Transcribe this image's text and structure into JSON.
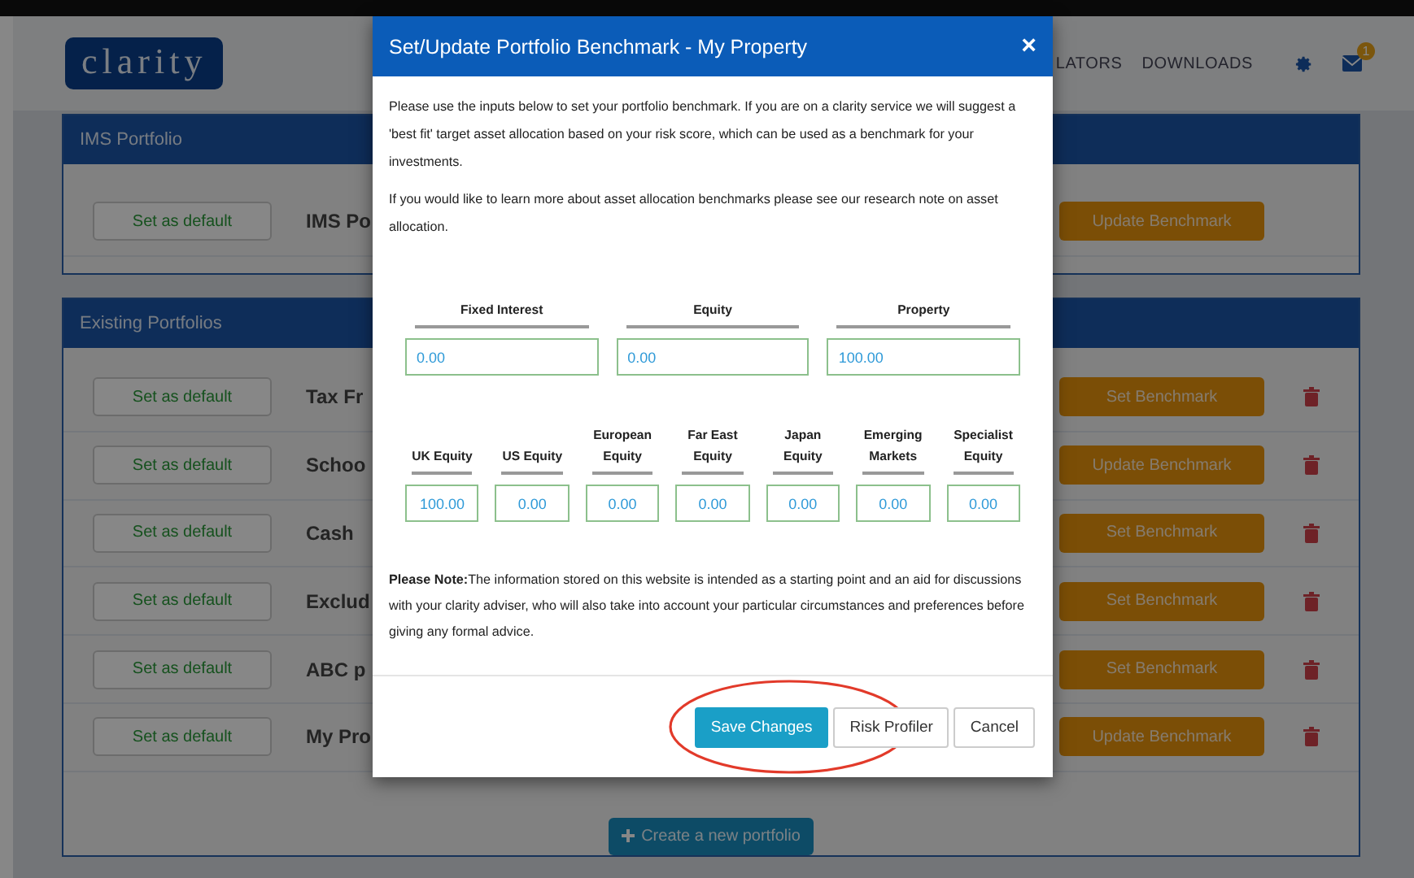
{
  "header": {
    "logo": "clarity",
    "nav": [
      "LATORS",
      "DOWNLOADS"
    ],
    "notification_badge": "1"
  },
  "ims_panel": {
    "title": "IMS Portfolio",
    "rows": [
      {
        "default_button": "Set as default",
        "name": "IMS Po",
        "benchmark_button": "Update Benchmark",
        "deletable": false
      }
    ]
  },
  "existing_panel": {
    "title": "Existing Portfolios",
    "rows": [
      {
        "default_button": "Set as default",
        "name": "Tax Fr",
        "benchmark_button": "Set Benchmark",
        "deletable": true
      },
      {
        "default_button": "Set as default",
        "name": "Schoo",
        "benchmark_button": "Update Benchmark",
        "deletable": true
      },
      {
        "default_button": "Set as default",
        "name": "Cash",
        "benchmark_button": "Set Benchmark",
        "deletable": true
      },
      {
        "default_button": "Set as default",
        "name": "Exclud",
        "benchmark_button": "Set Benchmark",
        "deletable": true
      },
      {
        "default_button": "Set as default",
        "name": "ABC p",
        "benchmark_button": "Set Benchmark",
        "deletable": true
      },
      {
        "default_button": "Set as default",
        "name": "My Pro",
        "benchmark_button": "Update Benchmark",
        "deletable": true
      }
    ],
    "create_button": "Create a new portfolio"
  },
  "dialog": {
    "title": "Set/Update Portfolio Benchmark - My Property",
    "close": "×",
    "paragraphs": [
      "Please use the inputs below to set your portfolio benchmark. If you are on a clarity service we will suggest a 'best fit' target asset allocation based on your risk score, which can be used as a benchmark for your investments.",
      "If you would like to learn more about asset allocation benchmarks please see our research note on asset allocation."
    ],
    "asset_classes": [
      {
        "label": "Fixed Interest",
        "value": "0.00"
      },
      {
        "label": "Equity",
        "value": "0.00"
      },
      {
        "label": "Property",
        "value": "100.00"
      }
    ],
    "equity_regions": [
      {
        "label": "UK Equity",
        "value": "100.00"
      },
      {
        "label": "US Equity",
        "value": "0.00"
      },
      {
        "label": "European Equity",
        "value": "0.00"
      },
      {
        "label": "Far East Equity",
        "value": "0.00"
      },
      {
        "label": "Japan Equity",
        "value": "0.00"
      },
      {
        "label": "Emerging Markets",
        "value": "0.00"
      },
      {
        "label": "Specialist Equity",
        "value": "0.00"
      }
    ],
    "note": "**Please Note:**The information stored on this website is intended as a starting point and an aid for discussions with your clarity adviser, who will also take into account your particular circumstances and preferences before giving any formal advice.",
    "buttons": [
      {
        "label": "Save Changes",
        "kind": "primary",
        "circled": true
      },
      {
        "label": "Risk Profiler",
        "kind": "default",
        "circled": false
      },
      {
        "label": "Cancel",
        "kind": "default",
        "circled": false
      }
    ]
  }
}
